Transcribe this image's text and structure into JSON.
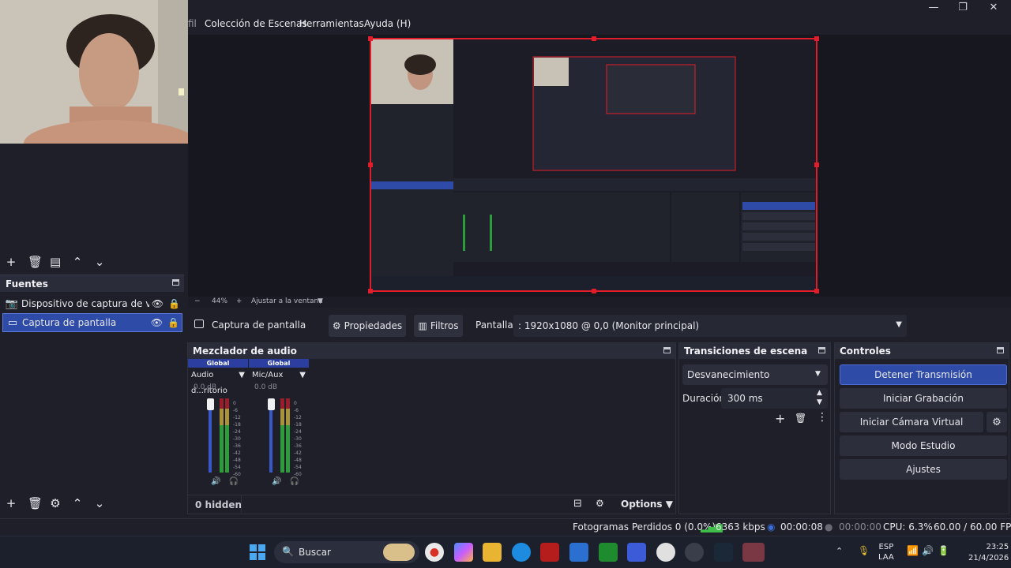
{
  "menu": {
    "partial_item": "fil",
    "items": [
      "Colección de Escenas",
      "Herramientas",
      "Ayuda (H)"
    ]
  },
  "window_controls": {
    "minimize": "—",
    "maximize": "❐",
    "close": "✕"
  },
  "zoom": {
    "minus": "−",
    "value": "44%",
    "plus": "+",
    "fit_label": "Ajustar a la ventana"
  },
  "sources": {
    "title": "Fuentes",
    "items": [
      {
        "label": "Dispositivo de captura de video",
        "icon": "camera-icon",
        "selected": false
      },
      {
        "label": "Captura de pantalla",
        "icon": "monitor-icon",
        "selected": true
      }
    ]
  },
  "properties_bar": {
    "source_label": "Captura de pantalla",
    "properties_button": "Propiedades",
    "filters_button": "Filtros",
    "display_label": "Pantalla",
    "display_value": ": 1920x1080 @ 0,0 (Monitor principal)"
  },
  "mixer": {
    "title": "Mezclador de audio",
    "channels": [
      {
        "header": "Global",
        "name": "Audio d...ritorio",
        "db": "0.0 dB"
      },
      {
        "header": "Global",
        "name": "Mic/Aux",
        "db": "0.0 dB"
      }
    ],
    "scale": [
      "0",
      "-6",
      "-12",
      "-18",
      "-24",
      "-30",
      "-36",
      "-42",
      "-48",
      "-54",
      "-60"
    ],
    "hidden_label": "0 hidden",
    "options_label": "Options"
  },
  "transitions": {
    "title": "Transiciones de escena",
    "selected": "Desvanecimiento",
    "duration_label": "Duración",
    "duration_value": "300 ms"
  },
  "controls": {
    "title": "Controles",
    "buttons": [
      "Detener Transmisión",
      "Iniciar Grabación",
      "Iniciar Cámara Virtual",
      "Modo Estudio",
      "Ajustes"
    ]
  },
  "status": {
    "dropped_frames": "Fotogramas Perdidos 0 (0.0%)",
    "bitrate": "6363 kbps",
    "stream_time": "00:00:08",
    "record_time": "00:00:00",
    "cpu": "CPU: 6.3%",
    "fps": "60.00 / 60.00 FPS"
  },
  "taskbar": {
    "search_placeholder": "Buscar",
    "language_line1": "ESP",
    "language_line2": "LAA",
    "time": "23:25",
    "date": "21/4/2026"
  },
  "colors": {
    "accent": "#2e4ba8",
    "selection_red": "#e11d2b",
    "panel_bg": "#1e1f29",
    "header_bg": "#2a2c3a"
  }
}
